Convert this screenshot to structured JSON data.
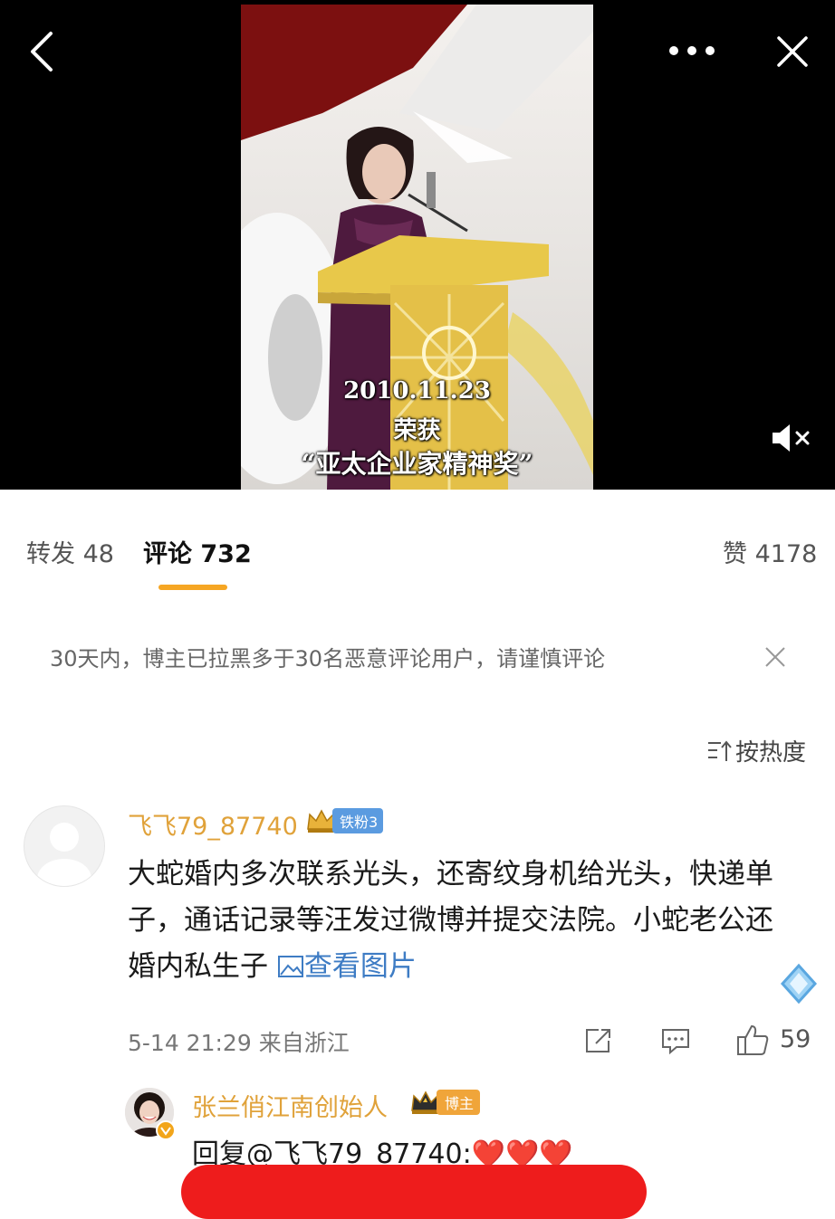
{
  "video": {
    "caption_date": "2010.11.23",
    "caption_line2": "荣获",
    "caption_line3": "“亚太企业家精神奖”",
    "back_icon": "chevron-left-icon",
    "more_icon": "more-dots-icon",
    "close_icon": "close-icon",
    "mute_icon": "speaker-muted-icon"
  },
  "tabs": {
    "repost": "转发 48",
    "comments": "评论 732",
    "likes": "赞 4178"
  },
  "notice": {
    "text": "30天内，博主已拉黑多于30名恶意评论用户，请谨慎评论"
  },
  "sort": {
    "label": "按热度"
  },
  "comment": {
    "username": "飞飞79_87740",
    "badge": "铁粉3",
    "text": "大蛇婚内多次联系光头，还寄纹身机给光头，快递单子，通话记录等汪发过微博并提交法院。小蛇老公还婚内私生子",
    "view_picture": "查看图片",
    "timestamp": "5-14 21:29",
    "location": "来自浙江",
    "like_count": "59"
  },
  "reply": {
    "username": "张兰俏江南创始人",
    "badge": "博主",
    "text": "回复@飞飞79_87740:❤️❤️❤️"
  },
  "colors": {
    "accent_orange": "#f6a623",
    "username_gold": "#e0a23a",
    "link_blue": "#3e7cc4",
    "redaction_red": "#ee1c1c"
  }
}
